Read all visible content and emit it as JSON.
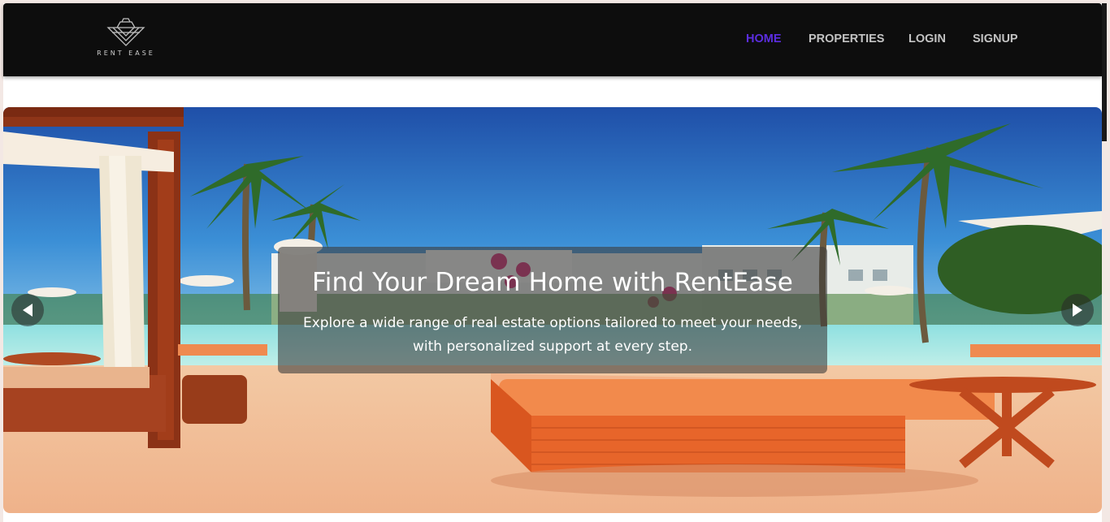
{
  "brand": {
    "logo_text": "RENT EASE",
    "logo_icon": "ship-icon"
  },
  "nav": {
    "items": [
      {
        "label": "HOME",
        "active": true
      },
      {
        "label": "PROPERTIES",
        "active": false
      },
      {
        "label": "LOGIN",
        "active": false
      },
      {
        "label": "SIGNUP",
        "active": false
      }
    ]
  },
  "hero": {
    "title": "Find Your Dream Home with RentEase",
    "subtitle": "Explore a wide range of real estate options tailored to meet your needs, with personalized support at every step.",
    "prev_icon": "chevron-left-icon",
    "next_icon": "chevron-right-icon"
  },
  "colors": {
    "navbar_bg": "#0d0d0d",
    "nav_text": "#c3c3c3",
    "nav_active": "#5b2de0"
  }
}
